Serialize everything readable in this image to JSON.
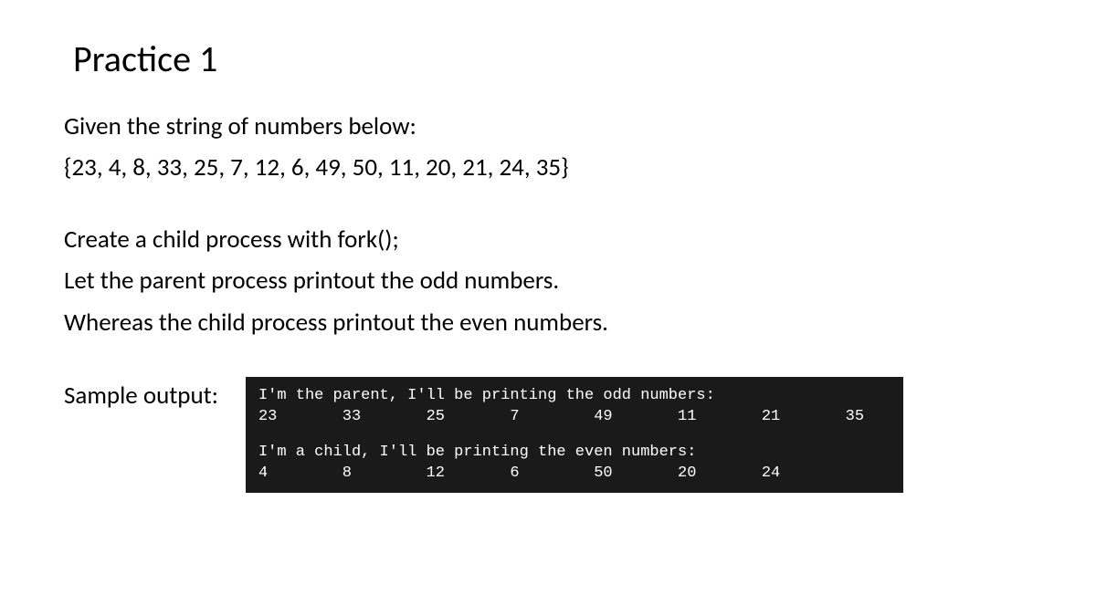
{
  "title": "Practice 1",
  "line1": "Given the string of numbers below:",
  "line2": "{23, 4, 8, 33, 25, 7, 12, 6, 49, 50, 11, 20, 21, 24, 35}",
  "line3": "Create a child process with fork();",
  "line4": "Let the parent process printout the odd numbers.",
  "line5": "Whereas the child process printout the even numbers.",
  "sample_label": "Sample output:",
  "terminal": {
    "parent_header": "I'm the parent, I'll be printing the odd numbers:",
    "parent_numbers": "23       33       25       7        49       11       21       35",
    "child_header": "I'm a child, I'll be printing the even numbers:",
    "child_numbers": "4        8        12       6        50       20       24"
  }
}
